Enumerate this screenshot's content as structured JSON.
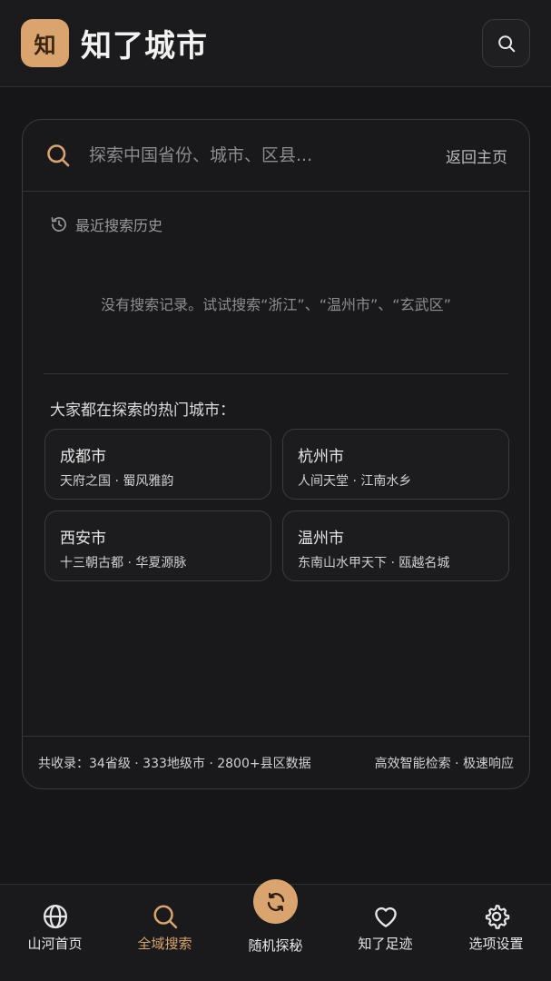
{
  "header": {
    "logo_char": "知",
    "title": "知了城市"
  },
  "search": {
    "placeholder": "探索中国省份、城市、区县...",
    "back_label": "返回主页"
  },
  "history": {
    "title": "最近搜索历史",
    "empty_text": "没有搜索记录。试试搜索“浙江”、“温州市”、“玄武区”"
  },
  "hot": {
    "title": "大家都在探索的热门城市：",
    "cities": [
      {
        "name": "成都市",
        "desc": "天府之国 · 蜀风雅韵"
      },
      {
        "name": "杭州市",
        "desc": "人间天堂 · 江南水乡"
      },
      {
        "name": "西安市",
        "desc": "十三朝古都 · 华夏源脉"
      },
      {
        "name": "温州市",
        "desc": "东南山水甲天下 · 瓯越名城"
      }
    ]
  },
  "footer": {
    "stats": "共收录：34省级 · 333地级市 · 2800+县区数据",
    "slogan": "高效智能检索 · 极速响应"
  },
  "nav": {
    "items": [
      {
        "label": "山河首页",
        "icon": "globe-icon"
      },
      {
        "label": "全域搜索",
        "icon": "search-icon"
      },
      {
        "label": "随机探秘",
        "icon": "refresh-icon"
      },
      {
        "label": "知了足迹",
        "icon": "heart-icon"
      },
      {
        "label": "选项设置",
        "icon": "gear-icon"
      }
    ],
    "active_index": 1
  },
  "colors": {
    "accent": "#d9a46d",
    "background": "#161618",
    "card": "#19191b"
  }
}
